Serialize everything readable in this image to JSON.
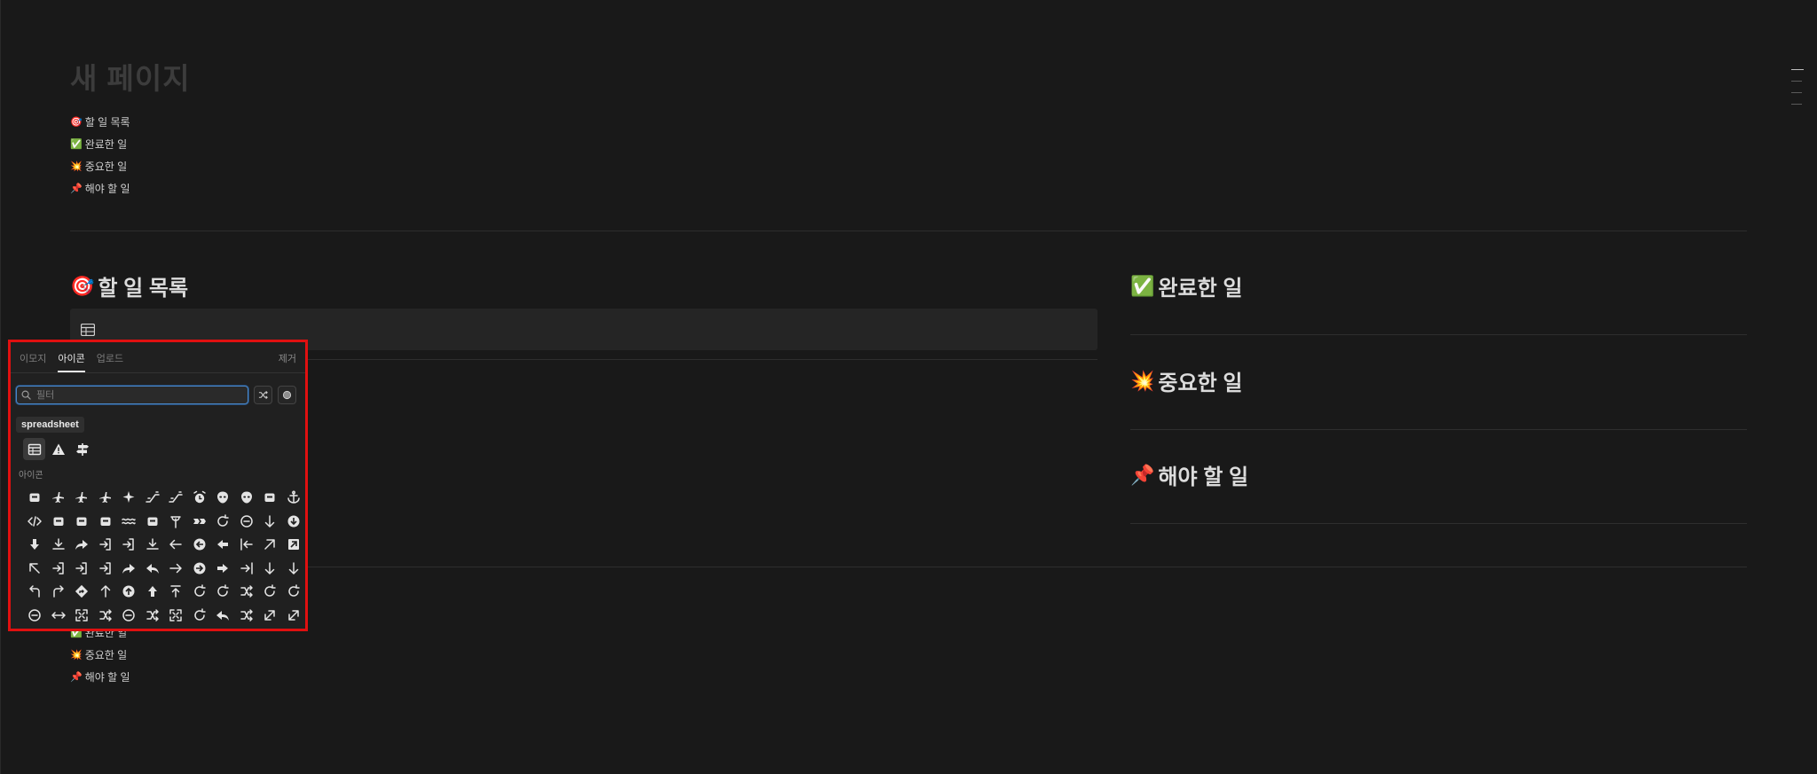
{
  "page": {
    "title": "새 페이지"
  },
  "toc": [
    {
      "emoji": "🎯",
      "label": "할 일 목록"
    },
    {
      "emoji": "✅",
      "label": "완료한 일"
    },
    {
      "emoji": "💥",
      "label": "중요한 일"
    },
    {
      "emoji": "📌",
      "label": "해야 할 일"
    }
  ],
  "columns": {
    "left": {
      "emoji": "🎯",
      "heading": "할 일 목록"
    },
    "right": [
      {
        "emoji": "✅",
        "heading": "완료한 일"
      },
      {
        "emoji": "💥",
        "heading": "중요한 일"
      },
      {
        "emoji": "📌",
        "heading": "해야 할 일"
      }
    ]
  },
  "toc_bottom": [
    {
      "emoji": "✅",
      "label": "완료한 일"
    },
    {
      "emoji": "💥",
      "label": "중요한 일"
    },
    {
      "emoji": "📌",
      "label": "해야 할 일"
    }
  ],
  "picker": {
    "tabs": [
      "이모지",
      "아이콘",
      "업로드"
    ],
    "active_tab": "아이콘",
    "remove_label": "제거",
    "search_placeholder": "필터",
    "tooltip": "spreadsheet",
    "recent_icons": [
      "table-icon",
      "warning-icon",
      "signpost-icon"
    ],
    "section_label": "아이콘",
    "icons": [
      "inbox-icon",
      "airplane-icon",
      "plane-landing-icon",
      "plane-takeoff-icon",
      "sparkle-icon",
      "escalator-down-icon",
      "escalator-up-icon",
      "alarm-clock-icon",
      "alien-icon",
      "monster-icon",
      "ambulance-icon",
      "anchor-icon",
      "code-icon",
      "apple-music-icon",
      "apple-icon",
      "battery-icon",
      "waves-icon",
      "archive-icon",
      "stand-icon",
      "double-arrow-icon",
      "refresh-icon",
      "undo-circle-icon",
      "arrow-down-icon",
      "arrow-down-circle-icon",
      "arrow-down-filled-icon",
      "download-icon",
      "forward-icon",
      "enter-icon",
      "login-icon",
      "download-tray-icon",
      "arrow-left-icon",
      "arrow-left-circle-icon",
      "arrow-left-filled-icon",
      "arrow-left-bar-icon",
      "arrow-up-right-icon",
      "arrow-up-right-square-icon",
      "arrow-up-left-icon",
      "logout-icon",
      "exit-icon",
      "share-icon",
      "forward-filled-icon",
      "reply-filled-icon",
      "arrow-right-icon",
      "arrow-right-circle-icon",
      "arrow-right-filled-icon",
      "arrow-right-bar-icon",
      "arrow-down-right-icon",
      "arrow-down-left-icon",
      "turn-left-icon",
      "turn-right-icon",
      "diamond-arrow-icon",
      "arrow-up-icon",
      "arrow-up-circle-icon",
      "arrow-up-filled-icon",
      "arrow-up-bar-icon",
      "undo-icon",
      "redo-icon",
      "split-icon",
      "repeat-icon",
      "rotate-icon",
      "circle-minus-icon",
      "arrows-horizontal-icon",
      "compress-icon",
      "swap-icon",
      "arrows-circle-icon",
      "merge-icon",
      "expand-icon",
      "loop-icon",
      "reply-all-icon",
      "shuffle-icon",
      "diagonal-icon",
      "diagonal-arrow-icon"
    ]
  }
}
